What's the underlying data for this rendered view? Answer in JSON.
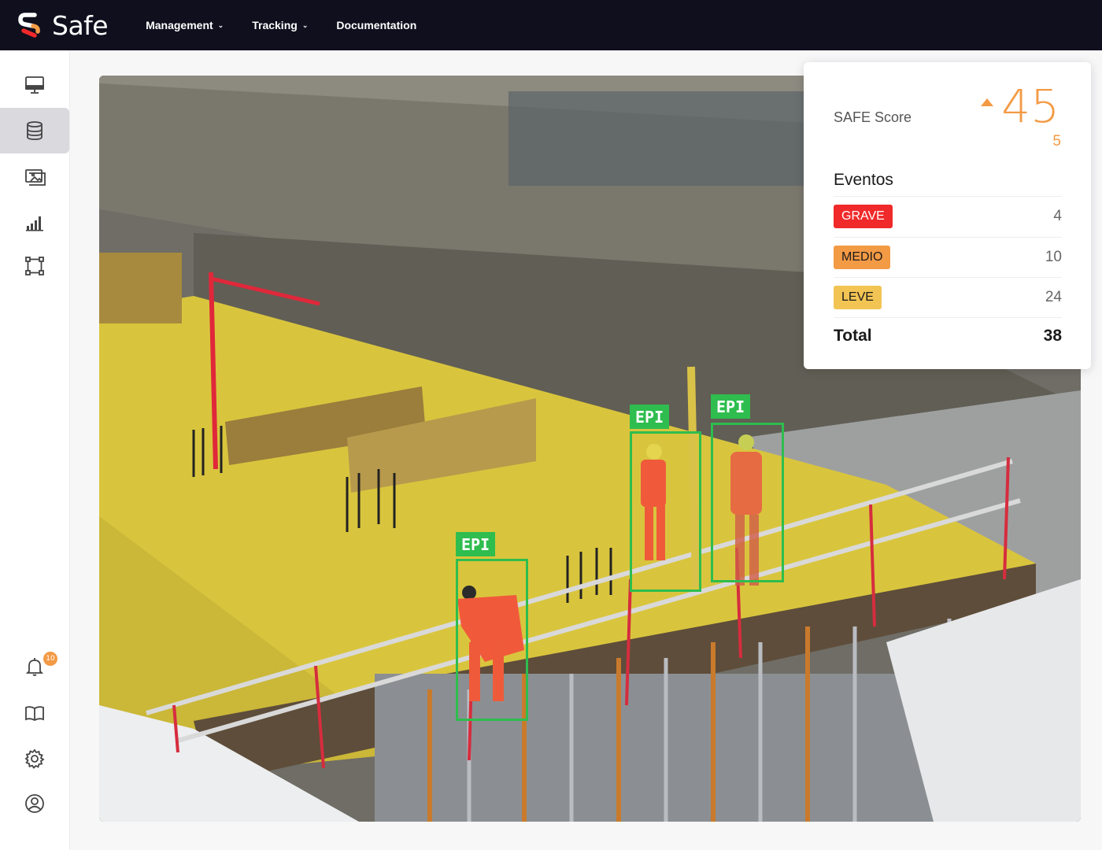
{
  "app": {
    "name": "Safe"
  },
  "nav": {
    "items": [
      {
        "label": "Management",
        "dropdown": true
      },
      {
        "label": "Tracking",
        "dropdown": true
      },
      {
        "label": "Documentation",
        "dropdown": false
      }
    ]
  },
  "sidebar": {
    "items": [
      {
        "icon": "monitor-icon",
        "active": false
      },
      {
        "icon": "database-icon",
        "active": true
      },
      {
        "icon": "gallery-icon",
        "active": false
      },
      {
        "icon": "bar-chart-icon",
        "active": false
      },
      {
        "icon": "vector-shape-icon",
        "active": false
      }
    ],
    "bottom": [
      {
        "icon": "bell-icon",
        "badge": "10"
      },
      {
        "icon": "book-icon"
      },
      {
        "icon": "gear-icon"
      },
      {
        "icon": "user-icon"
      }
    ]
  },
  "detections": [
    {
      "label": "EPI"
    },
    {
      "label": "EPI"
    },
    {
      "label": "EPI"
    }
  ],
  "score_card": {
    "label": "SAFE Score",
    "value": "45",
    "delta": "5",
    "events_title": "Eventos",
    "events": [
      {
        "level": "GRAVE",
        "count": "4",
        "bg": "#f0292a",
        "color": "#ffffff"
      },
      {
        "level": "MEDIO",
        "count": "10",
        "bg": "#f39a45",
        "color": "#1a1a1a"
      },
      {
        "level": "LEVE",
        "count": "24",
        "bg": "#f2c453",
        "color": "#1a1a1a"
      }
    ],
    "total_label": "Total",
    "total_value": "38"
  },
  "colors": {
    "accent": "#f39a45",
    "detection": "#2ebd4e",
    "topbar": "#0f0f1e"
  }
}
